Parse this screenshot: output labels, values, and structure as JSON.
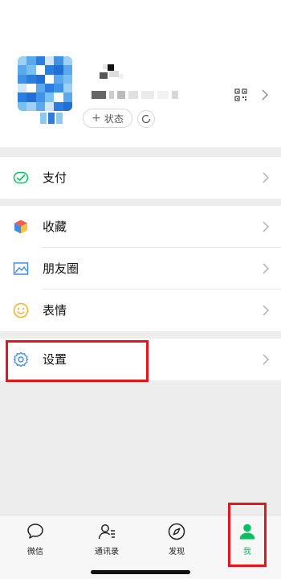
{
  "profile": {
    "status_label": "状态",
    "status_plus": "+"
  },
  "menu": {
    "pay": "支付",
    "favorites": "收藏",
    "moments": "朋友圈",
    "stickers": "表情",
    "settings": "设置"
  },
  "tabs": [
    {
      "label": "微信",
      "icon": "chat-bubble-icon"
    },
    {
      "label": "通讯录",
      "icon": "contacts-icon"
    },
    {
      "label": "发现",
      "icon": "compass-icon"
    },
    {
      "label": "我",
      "icon": "person-icon",
      "active": true
    }
  ],
  "colors": {
    "accent_green": "#07c160",
    "highlight_red": "#e8141b",
    "background": "#ededed"
  }
}
